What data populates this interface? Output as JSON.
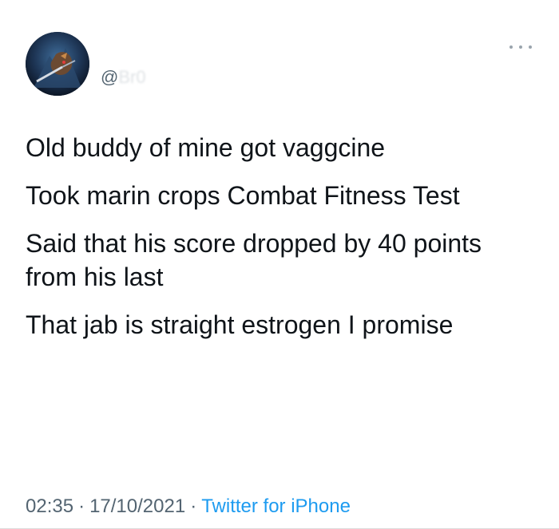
{
  "user": {
    "handle_prefix": "@",
    "handle_name": "Br0"
  },
  "icons": {
    "avatar": "avatar-image",
    "more": "more-horizontal-icon"
  },
  "tweet": {
    "lines": [
      "Old buddy of mine got vaggcine",
      "Took marin crops Combat Fitness Test",
      "Said that his score dropped by 40 points from his last",
      "That jab is straight estrogen I promise"
    ]
  },
  "meta": {
    "time": "02:35",
    "separator": "·",
    "date": "17/10/2021",
    "source": "Twitter for iPhone"
  },
  "colors": {
    "text": "#0f1419",
    "muted": "#536471",
    "link": "#1d9bf0"
  }
}
